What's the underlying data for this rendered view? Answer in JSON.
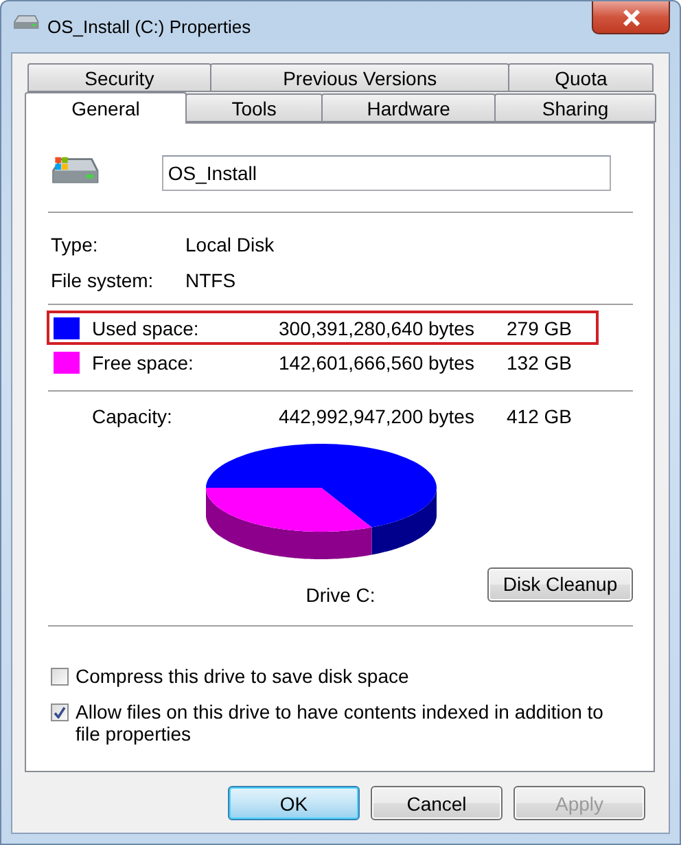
{
  "window": {
    "title": "OS_Install (C:) Properties"
  },
  "tab_rows": [
    [
      {
        "label": "Security",
        "selected": false
      },
      {
        "label": "Previous Versions",
        "selected": false
      },
      {
        "label": "Quota",
        "selected": false
      }
    ],
    [
      {
        "label": "General",
        "selected": true
      },
      {
        "label": "Tools",
        "selected": false
      },
      {
        "label": "Hardware",
        "selected": false
      },
      {
        "label": "Sharing",
        "selected": false
      }
    ]
  ],
  "drive_name": {
    "value": "OS_Install"
  },
  "info": [
    {
      "label": "Type:",
      "value": "Local Disk"
    },
    {
      "label": "File system:",
      "value": "NTFS"
    }
  ],
  "space": [
    {
      "label": "Used space:",
      "bytes": "300,391,280,640 bytes",
      "size": "279 GB",
      "color": "#0000ff",
      "highlighted": true
    },
    {
      "label": "Free space:",
      "bytes": "142,601,666,560 bytes",
      "size": "132 GB",
      "color": "#ff00ff",
      "highlighted": false
    }
  ],
  "capacity": {
    "label": "Capacity:",
    "bytes": "442,992,947,200 bytes",
    "size": "412 GB"
  },
  "usage_pie": {
    "label": "Drive C:"
  },
  "disk_cleanup": "Disk Cleanup",
  "options": [
    {
      "label": "Compress this drive to save disk space",
      "checked": false
    },
    {
      "label": "Allow files on this drive to have contents indexed in addition to file properties",
      "checked": true
    }
  ],
  "buttons": [
    {
      "label": "OK",
      "kind": "default",
      "disabled": false
    },
    {
      "label": "Cancel",
      "kind": "normal",
      "disabled": false
    },
    {
      "label": "Apply",
      "kind": "normal",
      "disabled": true
    }
  ]
}
